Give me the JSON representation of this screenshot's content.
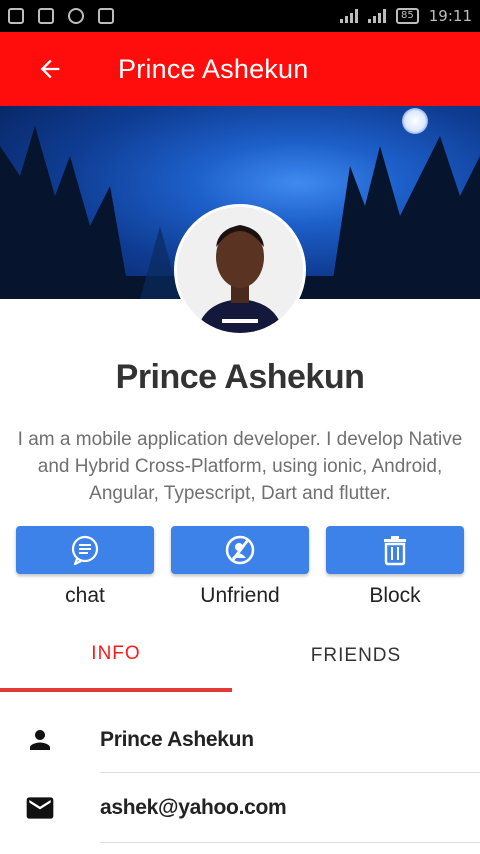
{
  "status_bar": {
    "time": "19:11",
    "battery": "85"
  },
  "header": {
    "title": "Prince Ashekun",
    "back_icon": "arrow-left-icon",
    "background": "#ff0d0d"
  },
  "profile": {
    "name": "Prince Ashekun",
    "bio": "I am a mobile application developer. I develop Native and Hybrid Cross-Platform, using ionic, Android, Angular, Typescript, Dart and flutter."
  },
  "actions": [
    {
      "label": "chat",
      "icon": "chat-bubble-icon"
    },
    {
      "label": "Unfriend",
      "icon": "unfriend-icon"
    },
    {
      "label": "Block",
      "icon": "trash-icon"
    }
  ],
  "tabs": [
    {
      "label": "INFO",
      "active": true
    },
    {
      "label": "FRIENDS",
      "active": false
    }
  ],
  "info": [
    {
      "icon": "person-icon",
      "value": "Prince Ashekun"
    },
    {
      "icon": "mail-icon",
      "value": "ashek@yahoo.com"
    }
  ],
  "colors": {
    "accent": "#ff0d0d",
    "button": "#3d82e8",
    "active_tab": "#ff1a1a"
  }
}
